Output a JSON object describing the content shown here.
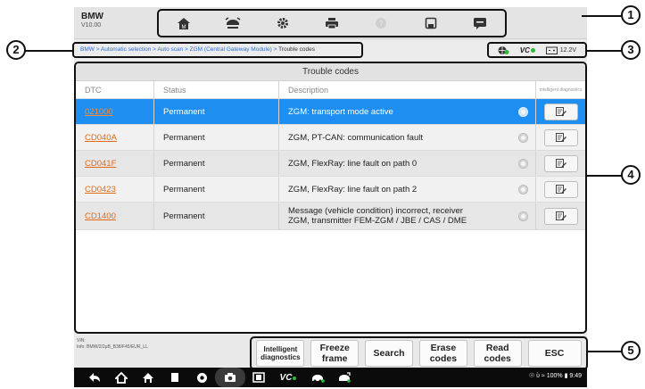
{
  "app": {
    "name": "BMW",
    "version": "V10.00"
  },
  "toolbar": {
    "icons": [
      "home-icon",
      "vehicle-lift-icon",
      "settings-gear-icon",
      "print-icon",
      "help-icon",
      "save-icon",
      "chat-icon"
    ]
  },
  "breadcrumb": {
    "path": "BMW > Automatic selection > Auto scan > ZGM (Central Gateway Module) > ",
    "current": "Trouble codes"
  },
  "status": {
    "voltage": "12.2V",
    "vci_label": "VC"
  },
  "panel": {
    "title": "Trouble codes",
    "columns": {
      "dtc": "DTC",
      "status": "Status",
      "description": "Description",
      "intelligent": "Intelligent diagnostics"
    },
    "rows": [
      {
        "code": "021000",
        "status": "Permanent",
        "description": "ZGM: transport mode active",
        "description2": ""
      },
      {
        "code": "CD040A",
        "status": "Permanent",
        "description": "ZGM, PT-CAN: communication fault",
        "description2": ""
      },
      {
        "code": "CD041F",
        "status": "Permanent",
        "description": "ZGM, FlexRay: line fault on path 0",
        "description2": ""
      },
      {
        "code": "CD0423",
        "status": "Permanent",
        "description": "ZGM, FlexRay: line fault on path 2",
        "description2": ""
      },
      {
        "code": "CD1400",
        "status": "Permanent",
        "description": "Message (vehicle condition) incorrect, receiver",
        "description2": "ZGM, transmitter FEM-ZGM / JBE / CAS / DME"
      }
    ]
  },
  "vehicle_info": {
    "vin_label": "VIN:",
    "info": "Info: BMW/2/2μB_B38/F45/EUR_LL"
  },
  "buttons": {
    "intelligent_1": "Intelligent",
    "intelligent_2": "diagnostics",
    "freeze_1": "Freeze",
    "freeze_2": "frame",
    "search": "Search",
    "erase_1": "Erase",
    "erase_2": "codes",
    "read_1": "Read",
    "read_2": "codes",
    "esc": "ESC"
  },
  "system_bar": {
    "status": "☉ ὺ ≈ 100% ▮ 9:49",
    "vci_label": "VC"
  },
  "callouts": [
    "1",
    "2",
    "3",
    "4",
    "5"
  ],
  "colors": {
    "selected_row": "#1e8ff0",
    "dtc_link": "#e36a15",
    "vci_green": "#2dbb3a"
  }
}
